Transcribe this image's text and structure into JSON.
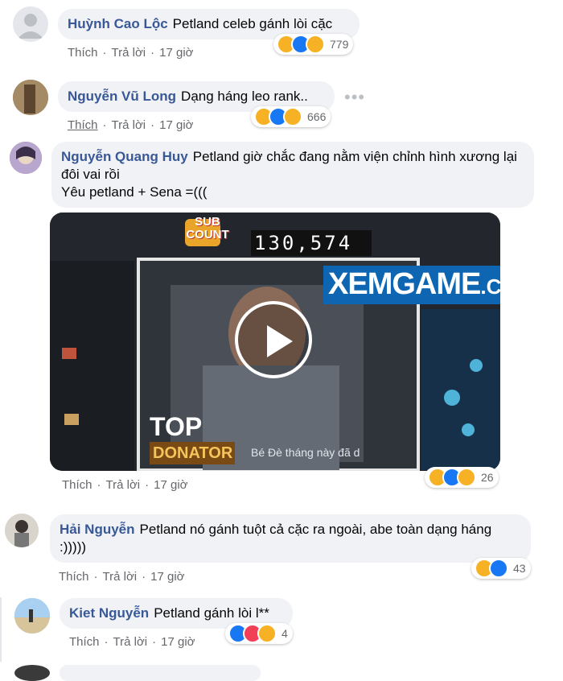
{
  "comments": [
    {
      "author": "Huỳnh Cao Lộc",
      "text": "Petland celeb gánh lòi cặc",
      "like": "Thích",
      "reply": "Trả lời",
      "time": "17 giờ",
      "reactions": "779"
    },
    {
      "author": "Nguyễn Vũ Long",
      "text": "Dạng háng leo rank..",
      "like": "Thích",
      "reply": "Trả lời",
      "time": "17 giờ",
      "reactions": "666"
    },
    {
      "author": "Nguyễn Quang Huy",
      "text": "Petland giờ chắc đang nằm viện chỉnh hình xương lại đôi vai rồi",
      "text2": "Yêu petland + Sena =(((",
      "like": "Thích",
      "reply": "Trả lời",
      "time": "17 giờ",
      "reactions": "26"
    },
    {
      "author": "Hải Nguyễn",
      "text": "Petland nó gánh tuột cả cặc ra ngoài, abe toàn dạng háng :)))))",
      "like": "Thích",
      "reply": "Trả lời",
      "time": "17 giờ",
      "reactions": "43"
    },
    {
      "author": "Kiet Nguyễn",
      "text": "Petland gánh lòi l**",
      "like": "Thích",
      "reply": "Trả lời",
      "time": "17 giờ",
      "reactions": "4"
    }
  ],
  "video": {
    "sub_count_label": "SUB COUNT",
    "sub_count": "130,574",
    "watermark": "XEMGAME",
    "watermark_suffix": ".COM",
    "top_label": "TOP",
    "donator_label": "DONATOR",
    "ticker": "Bé Đè tháng này đã d"
  },
  "more_label": "•••"
}
